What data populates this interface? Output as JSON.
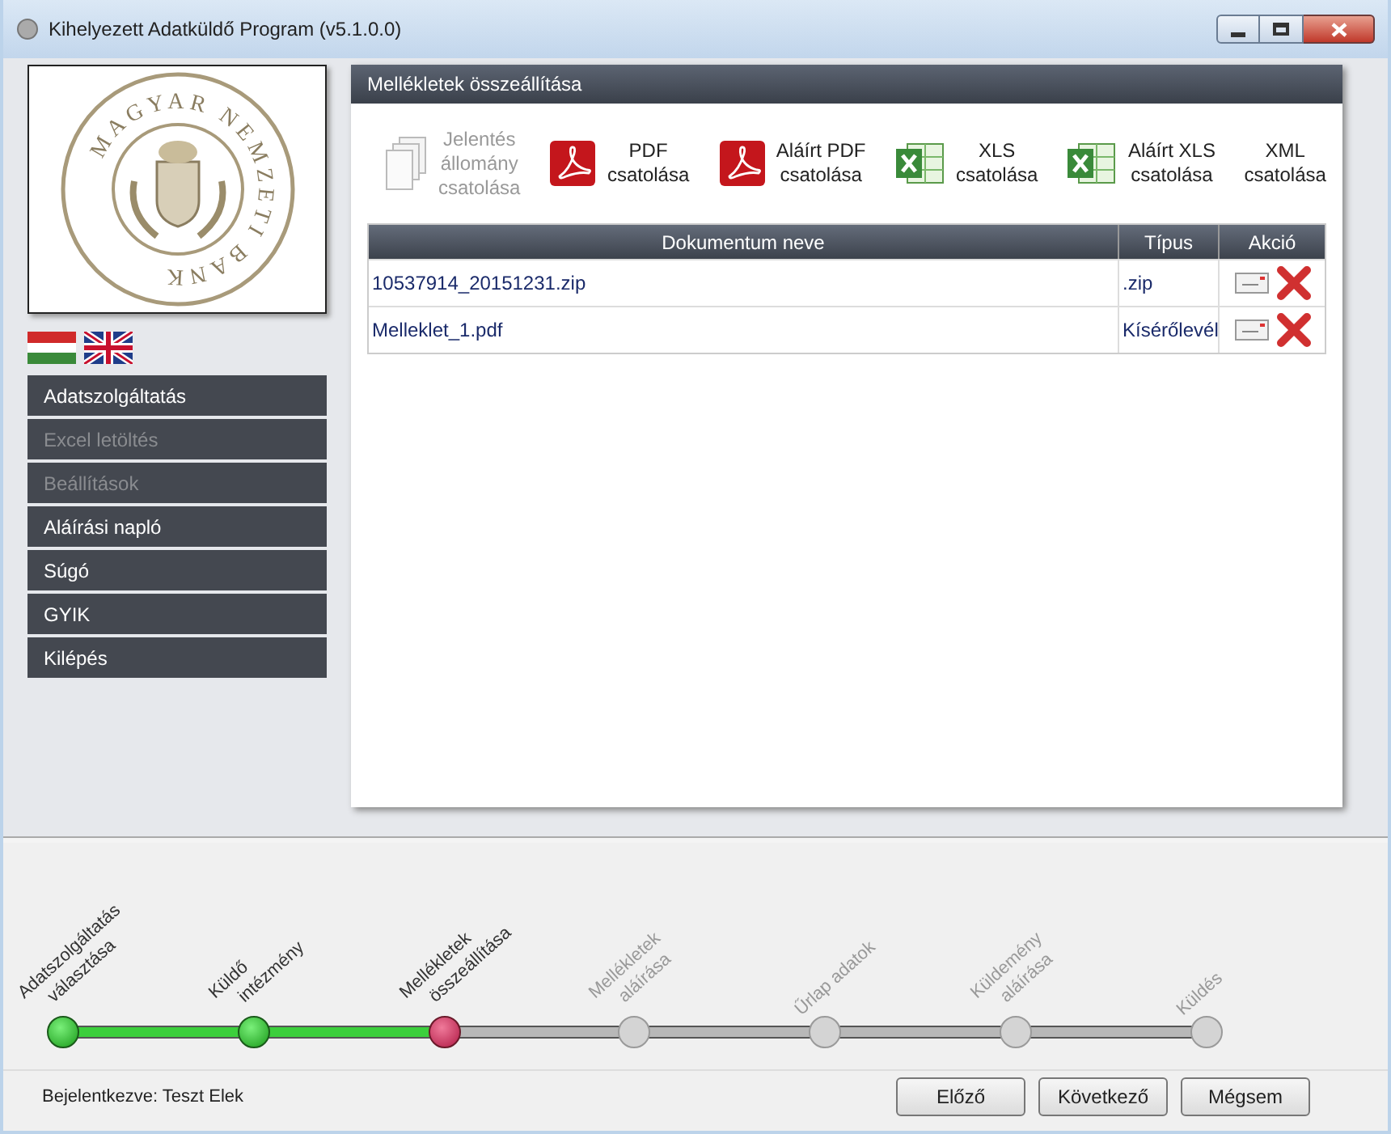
{
  "window": {
    "title": "Kihelyezett Adatküldő Program (v5.1.0.0)"
  },
  "logo_text": "MAGYAR NEMZETI BANK",
  "sidebar": {
    "items": [
      {
        "label": "Adatszolgáltatás",
        "disabled": false
      },
      {
        "label": "Excel letöltés",
        "disabled": true
      },
      {
        "label": "Beállítások",
        "disabled": true
      },
      {
        "label": "Aláírási napló",
        "disabled": false
      },
      {
        "label": "Súgó",
        "disabled": false
      },
      {
        "label": "GYIK",
        "disabled": false
      },
      {
        "label": "Kilépés",
        "disabled": false
      }
    ]
  },
  "panel": {
    "title": "Mellékletek összeállítása",
    "toolbar": [
      {
        "kind": "files",
        "lines": [
          "Jelentés",
          "állomány",
          "csatolása"
        ],
        "disabled": true
      },
      {
        "kind": "pdf",
        "lines": [
          "PDF",
          "csatolása"
        ],
        "disabled": false
      },
      {
        "kind": "pdf",
        "lines": [
          "Aláírt PDF",
          "csatolása"
        ],
        "disabled": false
      },
      {
        "kind": "xls",
        "lines": [
          "XLS",
          "csatolása"
        ],
        "disabled": false
      },
      {
        "kind": "xls",
        "lines": [
          "Aláírt XLS",
          "csatolása"
        ],
        "disabled": false
      },
      {
        "kind": "none",
        "lines": [
          "XML",
          "csatolása"
        ],
        "disabled": false
      }
    ],
    "table": {
      "columns": [
        "Dokumentum neve",
        "Típus",
        "Akció"
      ],
      "rows": [
        {
          "name": "10537914_20151231.zip",
          "type": ".zip"
        },
        {
          "name": "Melleklet_1.pdf",
          "type": "Kísérőlevél"
        }
      ]
    }
  },
  "steps": [
    {
      "lines": [
        "Adatszolgáltatás",
        "választása"
      ],
      "completed": true,
      "selected": false
    },
    {
      "lines": [
        "Küldő",
        "intézmény"
      ],
      "completed": true,
      "selected": false
    },
    {
      "lines": [
        "Mellékletek",
        "összeállítása"
      ],
      "completed": false,
      "selected": true
    },
    {
      "lines": [
        "Mellékletek",
        "aláírása"
      ],
      "completed": false,
      "selected": false
    },
    {
      "lines": [
        "Űrlap adatok"
      ],
      "completed": false,
      "selected": false
    },
    {
      "lines": [
        "Küldemény",
        "aláírása"
      ],
      "completed": false,
      "selected": false
    },
    {
      "lines": [
        "Küldés"
      ],
      "completed": false,
      "selected": false
    }
  ],
  "status_bar": {
    "user": "Bejelentkezve: Teszt Elek",
    "buttons": [
      "Előző",
      "Következő",
      "Mégsem"
    ]
  }
}
